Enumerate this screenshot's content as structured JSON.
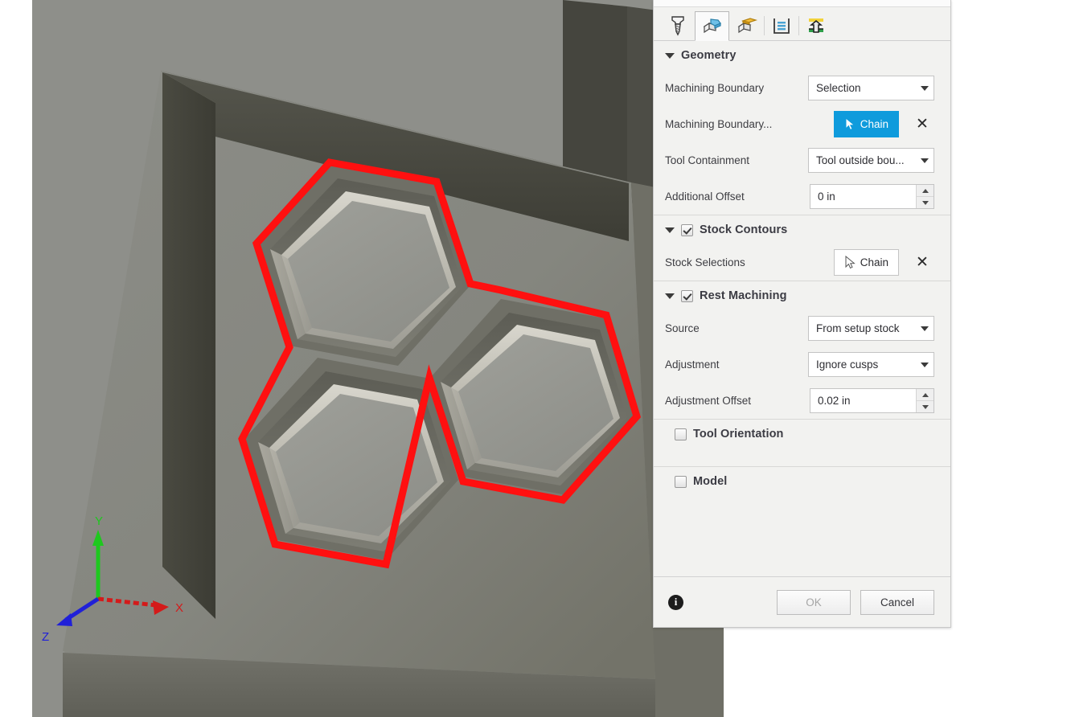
{
  "viewport": {
    "axis_triad": {
      "x_label": "X",
      "y_label": "Y",
      "z_label": "Z",
      "x_color": "#d41a1a",
      "y_color": "#1ec81e",
      "z_color": "#2020d8"
    },
    "selection_highlight_color": "#ff1010",
    "stock_color": "#8e8f8a",
    "pocket_wall_color": "#424239",
    "model_description": "Three hexagonal pockets arranged in a trefoil inside a rectangular pocket, with red chain selection outline"
  },
  "panel": {
    "tabs": [
      {
        "name": "tool-tab",
        "icon": "drill-bit-icon",
        "active": false
      },
      {
        "name": "geometry-tab",
        "icon": "geometry-box-icon",
        "active": true
      },
      {
        "name": "heights-tab",
        "icon": "heights-box-icon",
        "active": false
      },
      {
        "name": "passes-tab",
        "icon": "passes-layers-icon",
        "active": false
      },
      {
        "name": "linking-tab",
        "icon": "linking-icon",
        "active": false
      }
    ],
    "sections": {
      "geometry": {
        "title": "Geometry",
        "expanded": true,
        "rows": {
          "machining_boundary": {
            "label": "Machining Boundary",
            "value": "Selection",
            "options": [
              "Selection"
            ]
          },
          "machining_boundary_selection": {
            "label": "Machining Boundary...",
            "button_label": "Chain",
            "button_active": true,
            "clear_label": "✕"
          },
          "tool_containment": {
            "label": "Tool Containment",
            "value": "Tool outside bou...",
            "options": [
              "Tool outside bou..."
            ]
          },
          "additional_offset": {
            "label": "Additional Offset",
            "value": "0 in"
          }
        }
      },
      "stock_contours": {
        "title": "Stock Contours",
        "checked": true,
        "expanded": true,
        "rows": {
          "stock_selections": {
            "label": "Stock Selections",
            "button_label": "Chain",
            "button_active": false,
            "clear_label": "✕"
          }
        }
      },
      "rest_machining": {
        "title": "Rest Machining",
        "checked": true,
        "expanded": true,
        "rows": {
          "source": {
            "label": "Source",
            "value": "From setup stock",
            "options": [
              "From setup stock"
            ]
          },
          "adjustment": {
            "label": "Adjustment",
            "value": "Ignore cusps",
            "options": [
              "Ignore cusps"
            ]
          },
          "adjustment_offset": {
            "label": "Adjustment Offset",
            "value": "0.02 in"
          }
        }
      },
      "tool_orientation": {
        "title": "Tool Orientation",
        "checked": false,
        "expanded": false
      },
      "model": {
        "title": "Model",
        "checked": false,
        "expanded": false
      }
    },
    "footer": {
      "info_label": "i",
      "ok_label": "OK",
      "ok_disabled": true,
      "cancel_label": "Cancel"
    },
    "accent_color": "#0f9bdc"
  }
}
